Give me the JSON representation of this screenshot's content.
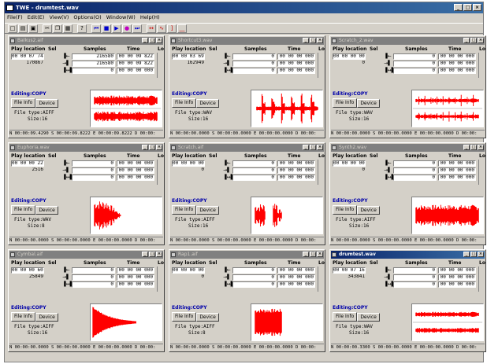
{
  "app": {
    "title": "TWE - drumtest.wav",
    "icon": "app-icon"
  },
  "window_buttons": [
    "_",
    "□",
    "×"
  ],
  "menu": [
    "File(F)",
    "Edit(E)",
    "View(V)",
    "Options(O)",
    "Window(W)",
    "Help(H)"
  ],
  "toolbar": [
    {
      "name": "new-file-icon",
      "glyph": "□"
    },
    {
      "name": "open-file-icon",
      "glyph": "▤"
    },
    {
      "name": "save-file-icon",
      "glyph": "▣"
    },
    {
      "name": "cut-icon",
      "glyph": "✂"
    },
    {
      "name": "copy-icon",
      "glyph": "❐"
    },
    {
      "name": "paste-icon",
      "glyph": "▦"
    },
    {
      "name": "help-icon",
      "glyph": "?"
    },
    {
      "name": "skip-back-icon",
      "glyph": "⏮"
    },
    {
      "name": "stop-icon",
      "glyph": "■"
    },
    {
      "name": "play-icon",
      "glyph": "▶"
    },
    {
      "name": "record-icon",
      "glyph": "●"
    },
    {
      "name": "skip-forward-icon",
      "glyph": "⏭"
    },
    {
      "name": "zoom-icon",
      "glyph": "↔"
    },
    {
      "name": "wave-icon",
      "glyph": "∿"
    },
    {
      "name": "bracket-icon",
      "glyph": "]"
    },
    {
      "name": "select-icon",
      "glyph": "⎽"
    }
  ],
  "labels": {
    "play_location": "Play location",
    "sel": "Sel",
    "samples": "Samples",
    "time": "Time",
    "lo": "Lo",
    "file_info": "File Info",
    "device": "Device"
  },
  "colors": {
    "wave": "#ff0000"
  },
  "windows": [
    {
      "title": "Balkus2.aif",
      "active": false,
      "play_time": "00 00 07 748",
      "play_samples": "170867",
      "samples": [
        "216580",
        "216580",
        "0"
      ],
      "times": [
        "00 00 09 822",
        "00 00 09 822",
        "00 00 00 000"
      ],
      "editing": "Editing:COPY",
      "file_type": "File type:AIFF",
      "size": "Size:16",
      "status": "N 00:00:09.4290 S 00:00:09.8222 E 00:00:09.8222 D 00:00:",
      "wave": "dense-stereo"
    },
    {
      "title": "Shortcut3.wav",
      "active": false,
      "play_time": "00 00 03 694",
      "play_samples": "162949",
      "samples": [
        "0",
        "0",
        "0"
      ],
      "times": [
        "00 00 00 000",
        "00 00 00 000",
        "00 00 00 000"
      ],
      "editing": "Editing:COPY",
      "file_type": "File type:WAV",
      "size": "Size:16",
      "status": "N 00:00:00.0000 S 00:00:00.0000 E 00:00:00.0000 D 00:00:",
      "wave": "spikes"
    },
    {
      "title": "Scratch_2.wav",
      "active": false,
      "play_time": "00 00 00 000",
      "play_samples": "0",
      "samples": [
        "0",
        "0",
        "0"
      ],
      "times": [
        "00 00 00 000",
        "00 00 00 000",
        "00 00 00 000"
      ],
      "editing": "Editing:COPY",
      "file_type": "File type:WAV",
      "size": "Size:16",
      "status": "N 00:00:00.0000 S 00:00:00.0000 E 00:00:00.0000 D 00:00:",
      "wave": "regular-stereo"
    },
    {
      "title": "Euphoria.wav",
      "active": false,
      "play_time": "00 00 00 228",
      "play_samples": "2516",
      "samples": [
        "0",
        "0",
        "0"
      ],
      "times": [
        "00 00 00 000",
        "00 00 00 000",
        "00 00 00 000"
      ],
      "editing": "Editing:COPY",
      "file_type": "File type:WAV",
      "size": "Size:8",
      "status": "N 00:00:00.0000 S 00:00:00.0000 E 00:00:00.0000 D 00:00:",
      "wave": "burst"
    },
    {
      "title": "Scratch.aif",
      "active": false,
      "play_time": "00 00 00 000",
      "play_samples": "0",
      "samples": [
        "0",
        "0",
        "0"
      ],
      "times": [
        "00 00 00 000",
        "00 00 00 000",
        "00 00 00 000"
      ],
      "editing": "Editing:COPY",
      "file_type": "File type:AIFF",
      "size": "Size:16",
      "status": "N 00:00:00.0000 S 00:00:00.0000 E 00:00:00.0000 D 00:00:",
      "wave": "two-spikes"
    },
    {
      "title": "Synth2.wav",
      "active": false,
      "play_time": "00 00 00 000",
      "play_samples": "0",
      "samples": [
        "0",
        "0",
        "0"
      ],
      "times": [
        "00 00 00 000",
        "00 00 00 000",
        "00 00 00 000"
      ],
      "editing": "Editing:COPY",
      "file_type": "File type:AIFF",
      "size": "Size:16",
      "status": "N 00:00:00.0000 S 00:00:00.0000 E 00:00:00.0000 D 00:00:",
      "wave": "dense-mono"
    },
    {
      "title": "Cymbal.aif",
      "active": false,
      "play_time": "00 00 00 606",
      "play_samples": "25849",
      "samples": [
        "0",
        "0",
        "0"
      ],
      "times": [
        "00 00 00 000",
        "00 00 00 000",
        "00 00 00 000"
      ],
      "editing": "Editing:COPY",
      "file_type": "File type:AIFF",
      "size": "Size:16",
      "status": "N 00:00:00.0000 S 00:00:00.0000 E 00:00:00.0000 D 00:00:",
      "wave": "decay"
    },
    {
      "title": "Rap1.aif",
      "active": false,
      "play_time": "00 00 00 000",
      "play_samples": "0",
      "samples": [
        "0",
        "0",
        "0"
      ],
      "times": [
        "00 00 00 000",
        "00 00 00 000",
        "00 00 00 000"
      ],
      "editing": "Editing:COPY",
      "file_type": "File type:AIFF",
      "size": "Size:8",
      "status": "N 00:00:00.0000 S 00:00:00.0000 E 00:00:00.0000 D 00:00:",
      "wave": "block"
    },
    {
      "title": "drumtest.wav",
      "active": true,
      "play_time": "00 00 07 163",
      "play_samples": "343841",
      "samples": [
        "0",
        "0",
        "0"
      ],
      "times": [
        "00 00 00 000",
        "00 00 00 000",
        "00 00 00 000"
      ],
      "editing": "Editing:COPY",
      "file_type": "File type:WAV",
      "size": "Size:16",
      "status": "N 00:00:00.3300 S 00:00:00.0000 E 00:00:00.0000 D 00:00:",
      "wave": "thin-stereo"
    }
  ]
}
